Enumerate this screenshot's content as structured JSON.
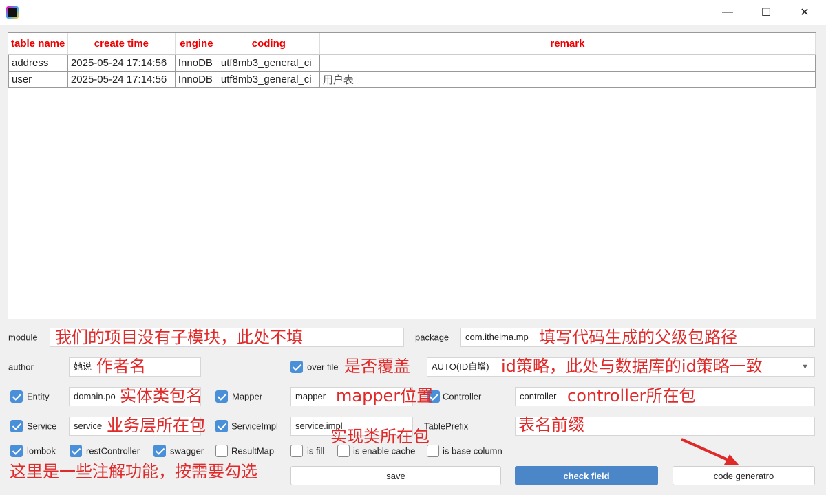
{
  "window": {
    "minimize": "—",
    "maximize": "☐",
    "close": "✕"
  },
  "table": {
    "headers": [
      "table name",
      "create time",
      "engine",
      "coding",
      "remark"
    ],
    "rows": [
      [
        "address",
        "2025-05-24 17:14:56",
        "InnoDB",
        "utf8mb3_general_ci",
        ""
      ],
      [
        "user",
        "2025-05-24 17:14:56",
        "InnoDB",
        "utf8mb3_general_ci",
        "用户表"
      ]
    ]
  },
  "form": {
    "module_label": "module",
    "module_value": "",
    "package_label": "package",
    "package_value": "com.itheima.mp",
    "author_label": "author",
    "author_value": "她说",
    "over_file_label": "over file",
    "over_file_checked": true,
    "id_strategy_value": "AUTO(ID自增)",
    "entity_label": "Entity",
    "entity_value": "domain.po",
    "mapper_label": "Mapper",
    "mapper_value": "mapper",
    "controller_label": "Controller",
    "controller_value": "controller",
    "service_label": "Service",
    "service_value": "service",
    "serviceimpl_label": "ServiceImpl",
    "serviceimpl_value": "service.impl",
    "tableprefix_label": "TablePrefix",
    "tableprefix_value": "",
    "options": [
      {
        "label": "lombok",
        "checked": true
      },
      {
        "label": "restController",
        "checked": true
      },
      {
        "label": "swagger",
        "checked": true
      },
      {
        "label": "ResultMap",
        "checked": false
      },
      {
        "label": "is fill",
        "checked": false
      },
      {
        "label": "is enable cache",
        "checked": false
      },
      {
        "label": "is base column",
        "checked": false
      }
    ]
  },
  "buttons": {
    "save": "save",
    "check_field": "check field",
    "code_generator": "code generatro"
  },
  "annotations": {
    "module": "我们的项目没有子模块，此处不填",
    "package": "填写代码生成的父级包路径",
    "author": "作者名",
    "over_file": "是否覆盖",
    "id_strategy": "id策略，此处与数据库的id策略一致",
    "entity": "实体类包名",
    "mapper": "mapper位置",
    "controller": "controller所在包",
    "service": "业务层所在包",
    "serviceimpl": "实现类所在包",
    "tableprefix": "表名前缀",
    "options": "这里是一些注解功能，按需要勾选"
  },
  "colors": {
    "accent": "#4a86c8",
    "annotation": "#e02a2a",
    "header_text": "#ee0000"
  }
}
